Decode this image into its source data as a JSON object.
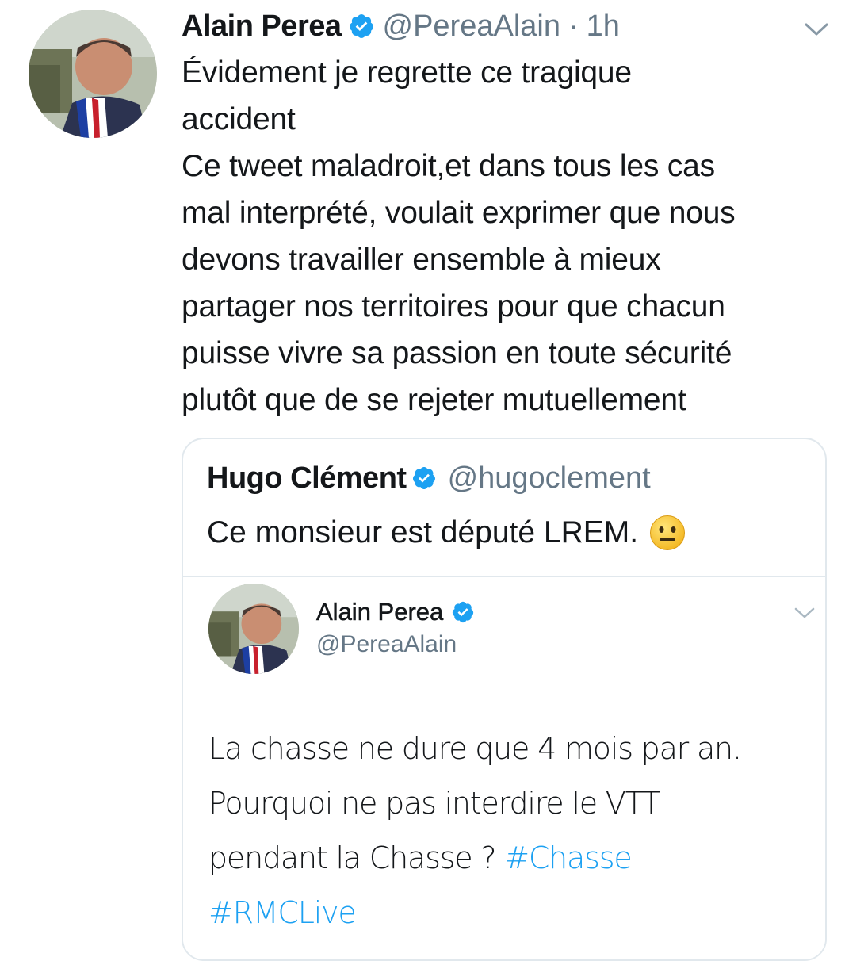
{
  "tweet": {
    "author": {
      "display_name": "Alain Perea",
      "handle": "@PereaAlain",
      "verified": true
    },
    "separator": "·",
    "time": "1h",
    "body_lines": [
      "Évidement je regrette ce tragique",
      "accident",
      "Ce tweet maladroit,et dans tous les cas",
      "mal interprété, voulait exprimer que nous",
      "devons travailler ensemble à mieux",
      "partager nos territoires pour que chacun",
      "puisse vivre sa passion en toute sécurité",
      "plutôt que de se rejeter mutuellement"
    ]
  },
  "quote": {
    "author": {
      "display_name": "Hugo Clément",
      "handle": "@hugoclement",
      "verified": true
    },
    "text": "Ce monsieur est député LREM.",
    "emoji": "neutral-face-emoji",
    "embedded_tweet": {
      "author": {
        "display_name": "Alain Perea",
        "handle": "@PereaAlain",
        "verified": true
      },
      "lines": [
        "La chasse ne dure que 4 mois par an.",
        "Pourquoi ne pas interdire le VTT",
        "pendant la Chasse ? ",
        ""
      ],
      "hashtags": [
        "#Chasse",
        "#RMCLive"
      ]
    }
  },
  "colors": {
    "primary_text": "#14171a",
    "secondary_text": "#657786",
    "accent": "#1da1f2",
    "border": "#e1e8ed"
  }
}
